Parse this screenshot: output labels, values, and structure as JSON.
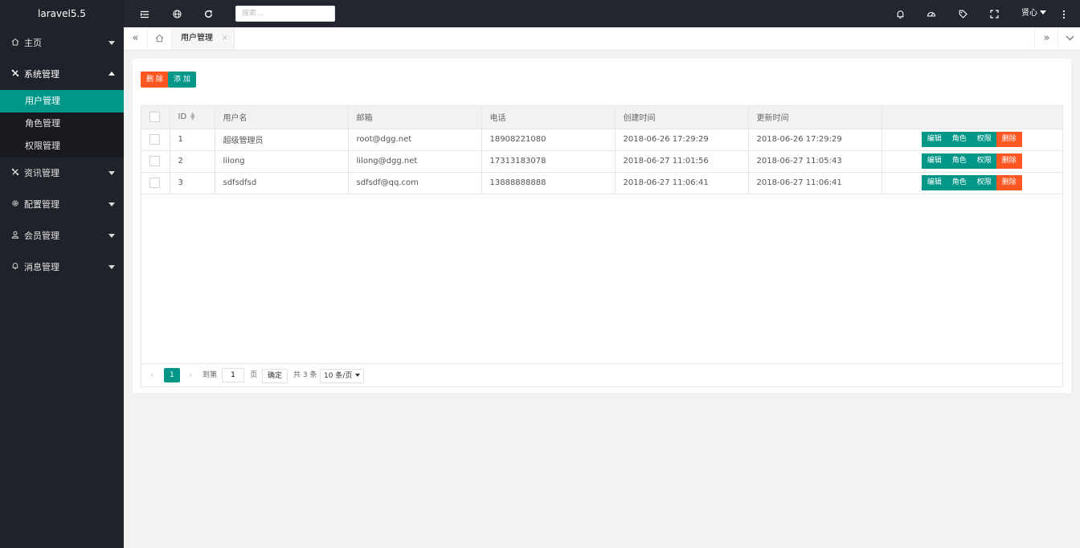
{
  "app": {
    "title": "laravel5.5"
  },
  "sidebar": {
    "items": [
      {
        "label": "主页",
        "icon": "home-icon",
        "expanded": false
      },
      {
        "label": "系统管理",
        "icon": "tools-icon",
        "expanded": true,
        "children": [
          {
            "label": "用户管理",
            "active": true
          },
          {
            "label": "角色管理",
            "active": false
          },
          {
            "label": "权限管理",
            "active": false
          }
        ]
      },
      {
        "label": "资讯管理",
        "icon": "tools-icon",
        "expanded": false
      },
      {
        "label": "配置管理",
        "icon": "gear-icon",
        "expanded": false
      },
      {
        "label": "会员管理",
        "icon": "user-icon",
        "expanded": false
      },
      {
        "label": "消息管理",
        "icon": "bell-icon",
        "expanded": false
      }
    ]
  },
  "header": {
    "search_placeholder": "搜索...",
    "user_name": "贤心",
    "icons": [
      "menu-toggle-icon",
      "globe-icon",
      "refresh-icon",
      "bell-icon",
      "theme-icon",
      "tag-icon",
      "fullscreen-icon",
      "more-icon"
    ]
  },
  "tabs": {
    "items": [
      {
        "label": "用户管理",
        "close": "×"
      }
    ]
  },
  "toolbar": {
    "delete_label": "删 除",
    "add_label": "添 加"
  },
  "table": {
    "columns": [
      "ID",
      "用户名",
      "邮箱",
      "电话",
      "创建时间",
      "更新时间"
    ],
    "rows": [
      {
        "id": "1",
        "name": "超级管理员",
        "email": "root@dgg.net",
        "phone": "18908221080",
        "created": "2018-06-26 17:29:29",
        "updated": "2018-06-26 17:29:29"
      },
      {
        "id": "2",
        "name": "lilong",
        "email": "lilong@dgg.net",
        "phone": "17313183078",
        "created": "2018-06-27 11:01:56",
        "updated": "2018-06-27 11:05:43"
      },
      {
        "id": "3",
        "name": "sdfsdfsd",
        "email": "sdfsdf@qq.com",
        "phone": "13888888888",
        "created": "2018-06-27 11:06:41",
        "updated": "2018-06-27 11:06:41"
      }
    ],
    "row_actions": {
      "edit": "编辑",
      "role": "角色",
      "perm": "权限",
      "delete": "删除"
    }
  },
  "pager": {
    "current": "1",
    "goto_label": "到第",
    "goto_value": "1",
    "page_unit": "页",
    "confirm_label": "确定",
    "total_label": "共 3 条",
    "page_size": "10 条/页"
  },
  "colors": {
    "accent": "#009688",
    "danger": "#ff5722",
    "sidebar_bg": "#20222a",
    "header_bg": "#23262e"
  }
}
